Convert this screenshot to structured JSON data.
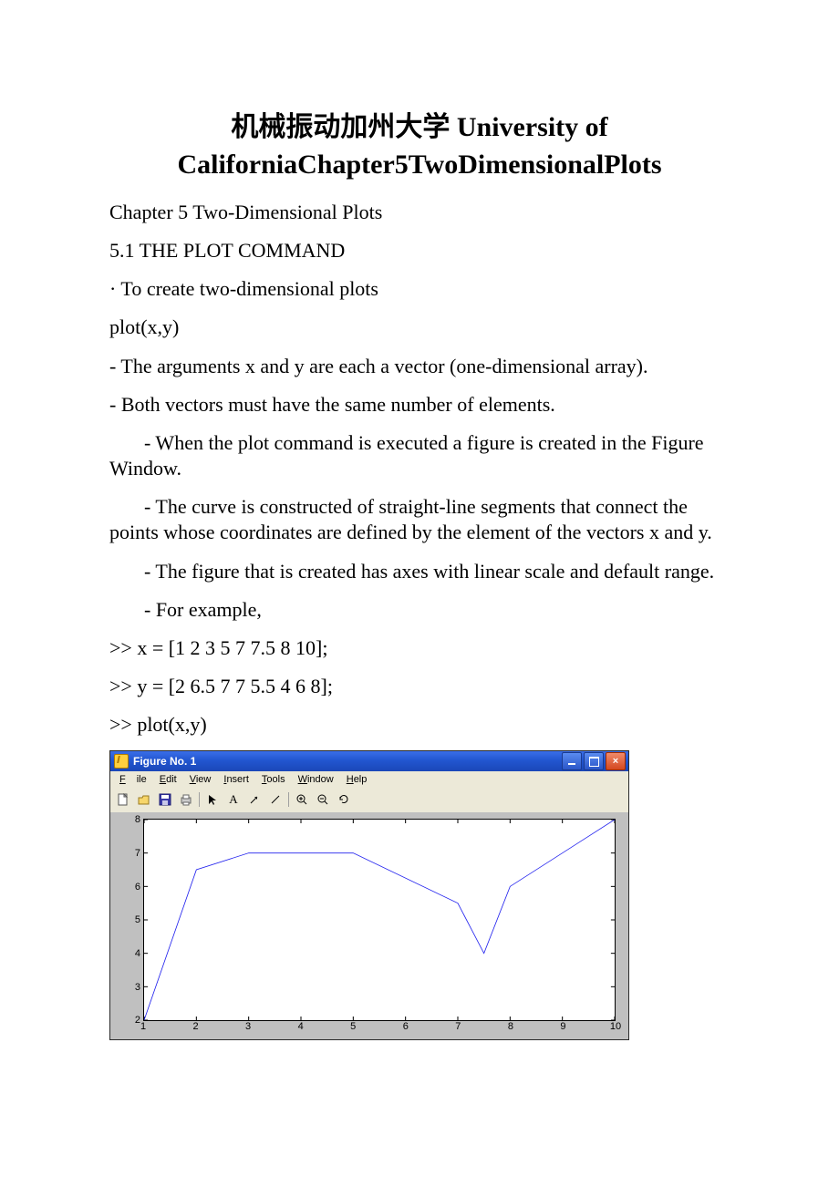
{
  "title": "机械振动加州大学 University of CaliforniaChapter5TwoDimensionalPlots",
  "lines": {
    "l1": "Chapter 5 Two-Dimensional Plots",
    "l2": "5.1 THE PLOT COMMAND",
    "l3": "· To create two-dimensional plots",
    "l4": "plot(x,y)",
    "l5": "- The arguments x and y are each a vector (one-dimensional array).",
    "l6": "- Both vectors must have the same number of elements.",
    "l7": "- When the plot command is executed a figure is created in the Figure Window.",
    "l8": "- The curve is constructed of straight-line segments that connect the points whose coordinates are defined by the element of the vectors x and y.",
    "l9": "- The figure that is created has axes with linear scale and default range.",
    "l10": "- For example,",
    "l11": ">> x = [1 2 3 5 7 7.5 8 10];",
    "l12": ">> y = [2 6.5 7 7 5.5 4 6 8];",
    "l13": ">> plot(x,y)"
  },
  "figure": {
    "caption": "Figure No. 1",
    "menus": {
      "file": "File",
      "edit": "Edit",
      "view": "View",
      "insert": "Insert",
      "tools": "Tools",
      "window": "Window",
      "help": "Help"
    }
  },
  "chart_data": {
    "type": "line",
    "x": [
      1,
      2,
      3,
      5,
      7,
      7.5,
      8,
      10
    ],
    "y": [
      2,
      6.5,
      7,
      7,
      5.5,
      4,
      6,
      8
    ],
    "xlim": [
      1,
      10
    ],
    "ylim": [
      2,
      8
    ],
    "xticks": [
      1,
      2,
      3,
      4,
      5,
      6,
      7,
      8,
      9,
      10
    ],
    "yticks": [
      2,
      3,
      4,
      5,
      6,
      7,
      8
    ],
    "title": "",
    "xlabel": "",
    "ylabel": ""
  }
}
